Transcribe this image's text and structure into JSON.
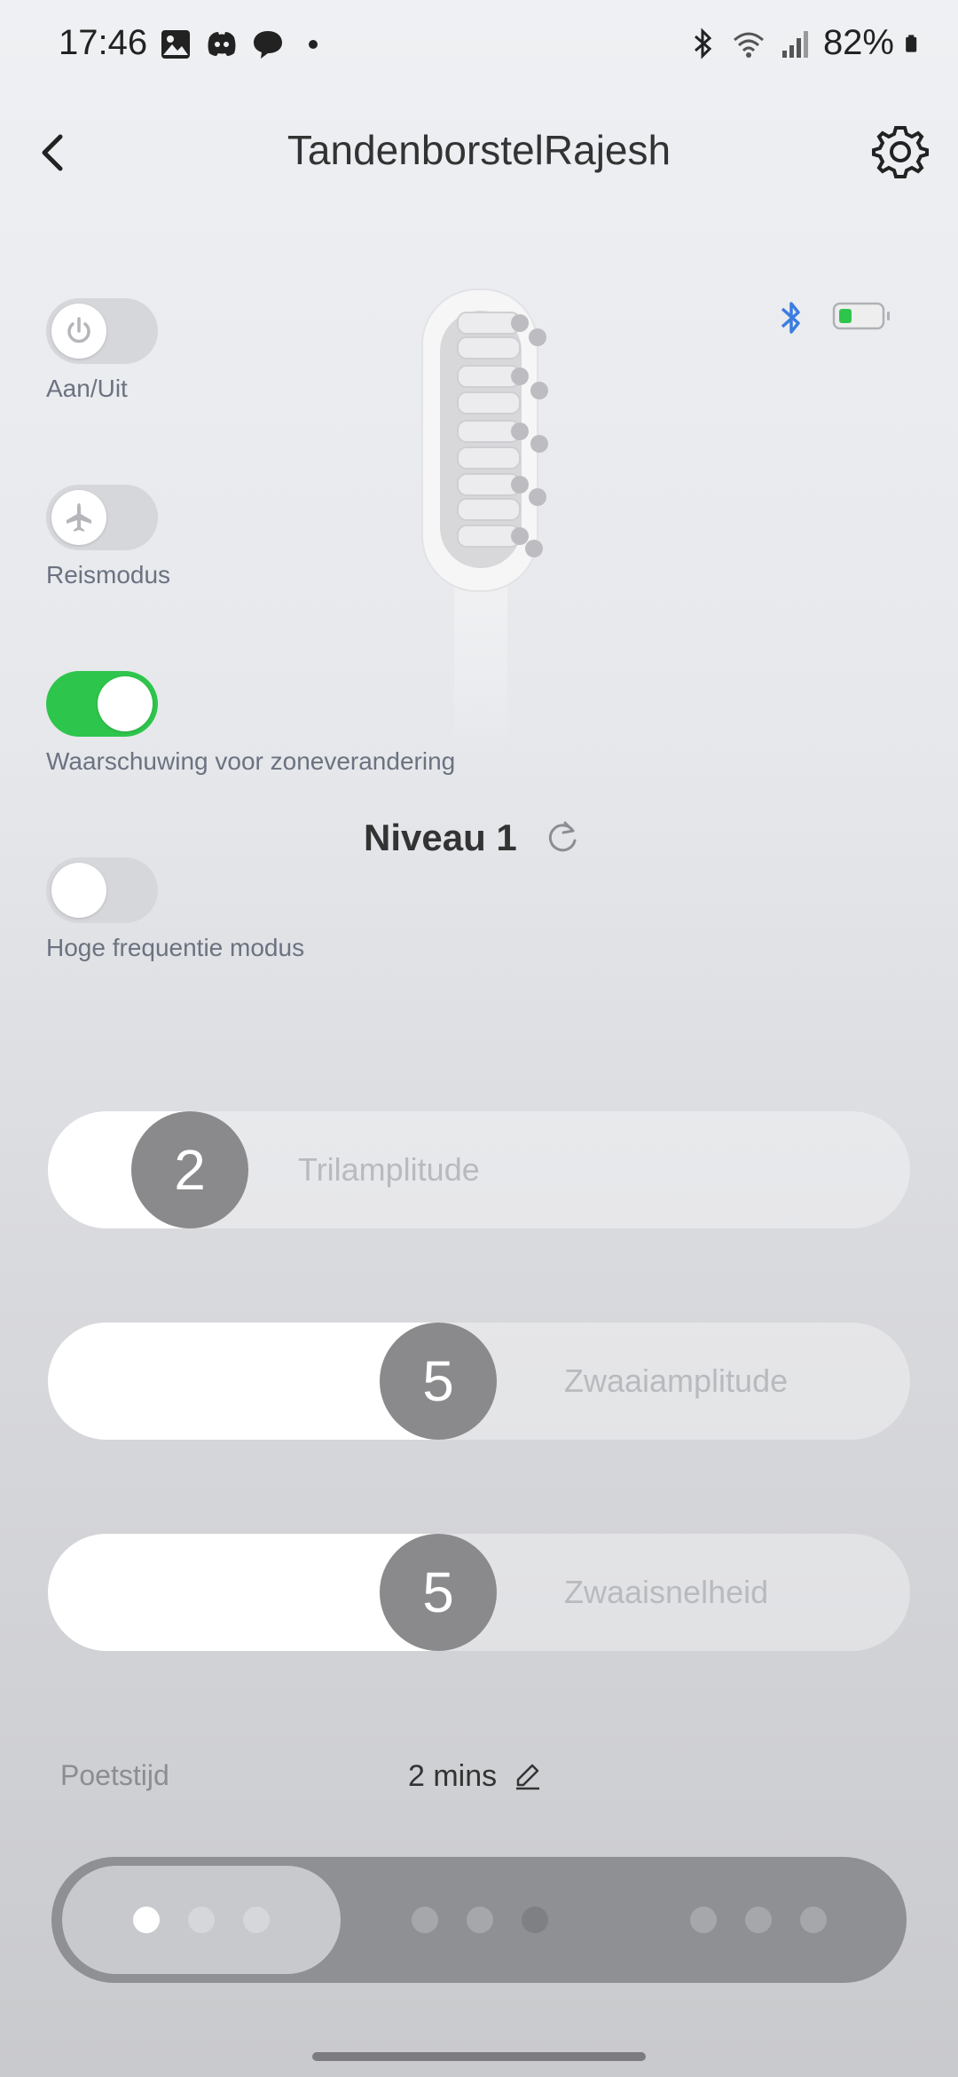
{
  "status_bar": {
    "time": "17:46",
    "battery_pct": "82%",
    "icons_left": [
      "gallery-icon",
      "discord-icon",
      "chat-icon",
      "dot"
    ],
    "icons_right": [
      "bluetooth-icon",
      "wifi-icon",
      "signal-icon",
      "battery-icon"
    ]
  },
  "header": {
    "title": "TandenborstelRajesh"
  },
  "toggles": [
    {
      "label": "Aan/Uit",
      "icon": "power-icon",
      "on": false
    },
    {
      "label": "Reismodus",
      "icon": "airplane-icon",
      "on": false
    },
    {
      "label": "Waarschuwing voor zoneverandering",
      "icon": "",
      "on": true
    },
    {
      "label": "Hoge frequentie modus",
      "icon": "",
      "on": false
    }
  ],
  "device_status": {
    "bluetooth_connected": true,
    "battery_color": "#2ec54c"
  },
  "level": {
    "text": "Niveau 1"
  },
  "sliders": [
    {
      "label": "Trilamplitude",
      "value": "2"
    },
    {
      "label": "Zwaaiamplitude",
      "value": "5"
    },
    {
      "label": "Zwaaisnelheid",
      "value": "5"
    }
  ],
  "brushing_time": {
    "label": "Poetstijd",
    "value": "2 mins"
  },
  "mode_selector": {
    "selected_index": 0
  },
  "colors": {
    "accent_green": "#2ec54c",
    "bluetooth_blue": "#3b7de0",
    "thumb_gray": "#8a8a8c"
  }
}
